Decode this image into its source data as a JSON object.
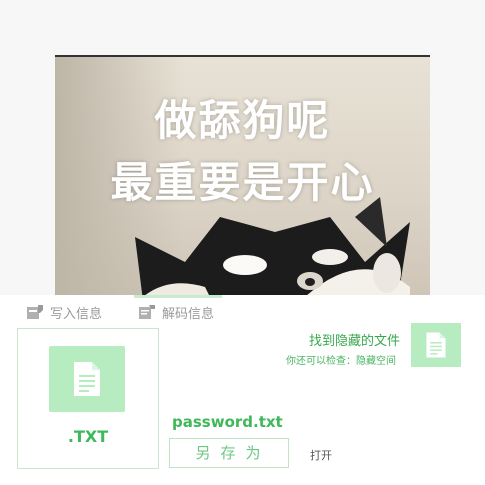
{
  "preview": {
    "caption_line1": "做舔狗呢",
    "caption_line2": "最重要是开心"
  },
  "tabs": [
    {
      "label": "写入信息",
      "icon": "write-icon",
      "active": false
    },
    {
      "label": "解码信息",
      "icon": "decode-icon",
      "active": true
    }
  ],
  "file_card": {
    "extension": ".TXT",
    "icon": "document-icon"
  },
  "found": {
    "title": "找到隐藏的文件",
    "subtitle": "你还可以检查：隐藏空间",
    "icon": "document-icon"
  },
  "file": {
    "name": "password.txt"
  },
  "actions": {
    "save_label": "另存为",
    "open_label": "打开"
  },
  "colors": {
    "accent": "#3fb85a",
    "accent_light": "#b7ebc0",
    "border": "#c9e7cf"
  }
}
